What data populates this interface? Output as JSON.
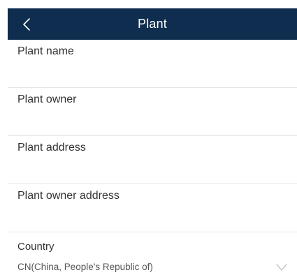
{
  "header": {
    "title": "Plant",
    "back_icon": "chevron-left-icon",
    "background_color": "#0f2d4e"
  },
  "form": {
    "fields": [
      {
        "label": "Plant name",
        "value": ""
      },
      {
        "label": "Plant owner",
        "value": ""
      },
      {
        "label": "Plant address",
        "value": ""
      },
      {
        "label": "Plant owner address",
        "value": ""
      }
    ],
    "country": {
      "label": "Country",
      "selected": "CN(China, People's Republic of)",
      "dropdown_icon": "chevron-down-icon"
    }
  }
}
